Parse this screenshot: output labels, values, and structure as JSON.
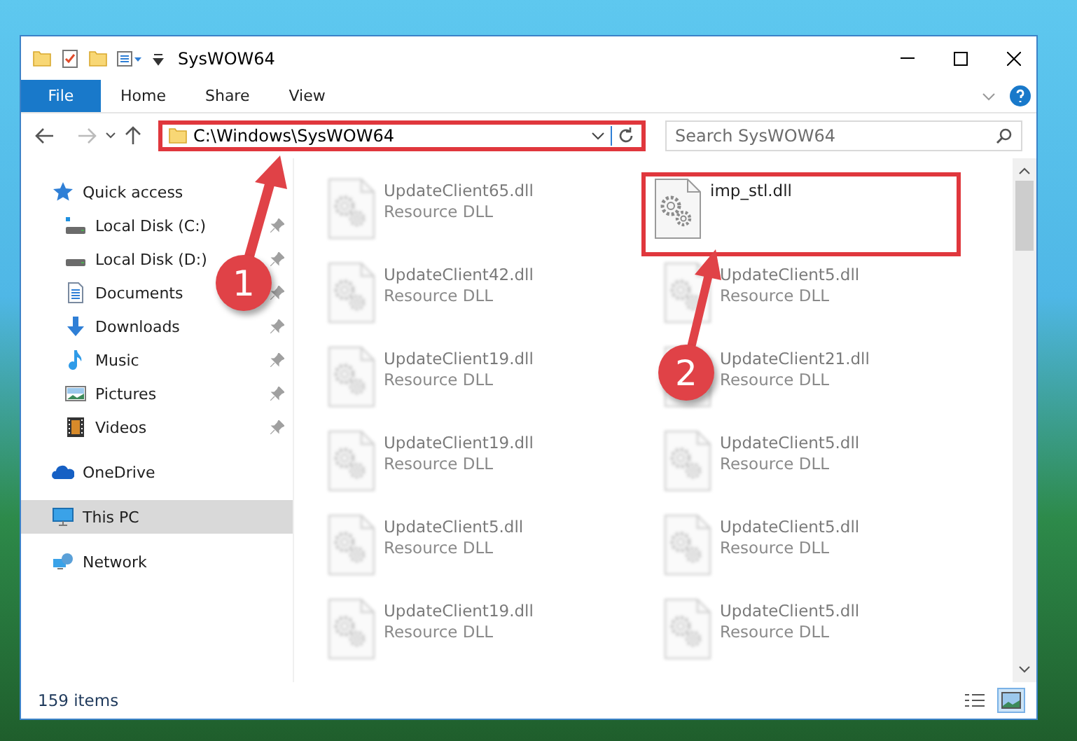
{
  "window": {
    "title": "SysWOW64"
  },
  "ribbon": {
    "tabs": [
      {
        "label": "File",
        "kind": "file",
        "selected": false
      },
      {
        "label": "Home",
        "kind": "tab",
        "selected": false
      },
      {
        "label": "Share",
        "kind": "tab",
        "selected": false
      },
      {
        "label": "View",
        "kind": "tab",
        "selected": false
      }
    ]
  },
  "address": {
    "path": "C:\\Windows\\SysWOW64",
    "highlighted": true
  },
  "search": {
    "placeholder": "Search SysWOW64"
  },
  "nav": [
    {
      "label": "Quick access",
      "kind": "star",
      "selected": false,
      "children": [
        {
          "label": "Local Disk (C:)",
          "kind": "system-drive",
          "pinned": true,
          "selected": false
        },
        {
          "label": "Local Disk (D:)",
          "kind": "drive",
          "pinned": true,
          "selected": false
        },
        {
          "label": "Documents",
          "kind": "documents",
          "pinned": true,
          "selected": false
        },
        {
          "label": "Downloads",
          "kind": "downloads",
          "pinned": true,
          "selected": false
        },
        {
          "label": "Music",
          "kind": "music",
          "pinned": true,
          "selected": false
        },
        {
          "label": "Pictures",
          "kind": "pictures",
          "pinned": true,
          "selected": false
        },
        {
          "label": "Videos",
          "kind": "videos",
          "pinned": true,
          "selected": false
        }
      ]
    },
    {
      "label": "OneDrive",
      "kind": "cloud",
      "selected": false
    },
    {
      "label": "This PC",
      "kind": "pc",
      "selected": true
    },
    {
      "label": "Network",
      "kind": "network",
      "selected": false
    }
  ],
  "files": [
    {
      "name": "UpdateClient65.dll",
      "type": "Resource DLL",
      "blurred": true,
      "highlighted": false
    },
    {
      "name": "imp_stl.dll",
      "blurred": false,
      "highlighted": true
    },
    {
      "name": "UpdateClient42.dll",
      "type": "Resource DLL",
      "blurred": true,
      "highlighted": false
    },
    {
      "name": "UpdateClient5.dll",
      "type": "Resource DLL",
      "blurred": true,
      "highlighted": false
    },
    {
      "name": "UpdateClient19.dll",
      "type": "Resource DLL",
      "blurred": true,
      "highlighted": false
    },
    {
      "name": "UpdateClient21.dll",
      "type": "Resource DLL",
      "blurred": true,
      "highlighted": false
    },
    {
      "name": "UpdateClient19.dll",
      "type": "Resource DLL",
      "blurred": true,
      "highlighted": false
    },
    {
      "name": "UpdateClient5.dll",
      "type": "Resource DLL",
      "blurred": true,
      "highlighted": false
    },
    {
      "name": "UpdateClient5.dll",
      "type": "Resource DLL",
      "blurred": true,
      "highlighted": false
    },
    {
      "name": "UpdateClient5.dll",
      "type": "Resource DLL",
      "blurred": true,
      "highlighted": false
    },
    {
      "name": "UpdateClient19.dll",
      "type": "Resource DLL",
      "blurred": true,
      "highlighted": false
    },
    {
      "name": "UpdateClient5.dll",
      "type": "Resource DLL",
      "blurred": true,
      "highlighted": false
    }
  ],
  "status_bar": {
    "count": "159 items",
    "view_buttons": [
      {
        "kind": "details",
        "selected": false
      },
      {
        "kind": "large-icons",
        "selected": true
      }
    ]
  },
  "annotations": [
    {
      "number": "1"
    },
    {
      "number": "2"
    }
  ]
}
